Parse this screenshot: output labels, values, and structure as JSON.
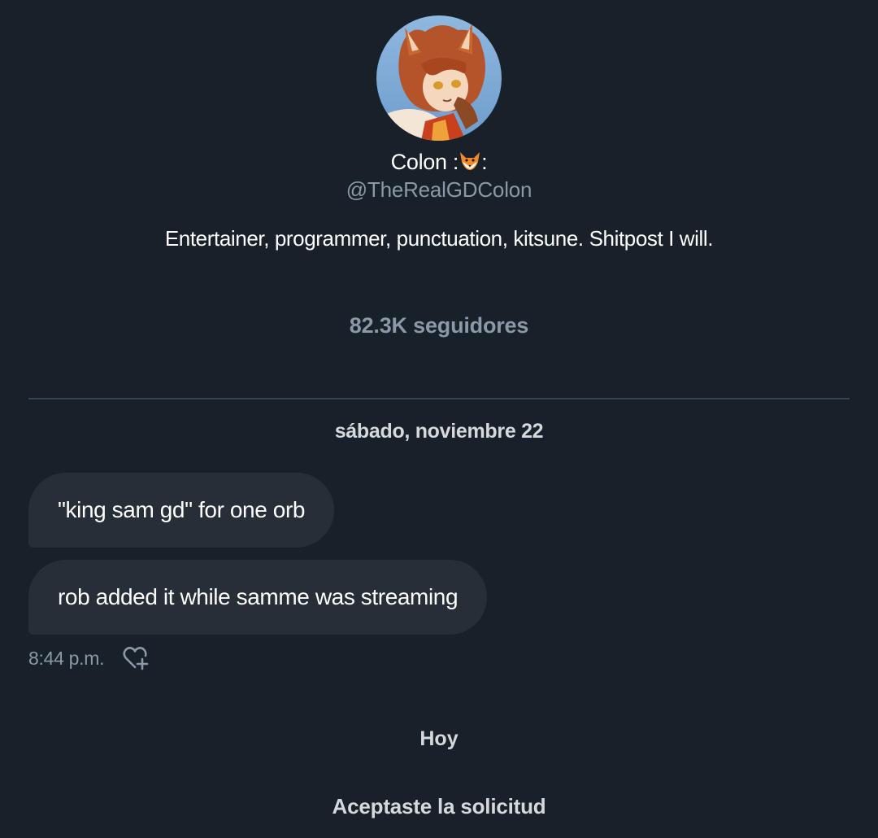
{
  "profile": {
    "display_name": "Colon :",
    "display_name_suffix": ":",
    "emoji": "fox-face-icon",
    "handle": "@TheRealGDColon",
    "bio": "Entertainer, programmer, punctuation, kitsune. Shitpost I will.",
    "followers": "82.3K seguidores"
  },
  "conversation": {
    "date_separator": "sábado, noviembre 22",
    "messages": [
      {
        "text": "\"king sam gd\" for one orb"
      },
      {
        "text": "rob added it while samme was streaming"
      }
    ],
    "last_message_time": "8:44 p.m.",
    "reaction_icon": "heart-plus-icon",
    "today_separator": "Hoy",
    "request_notice": "Aceptaste la solicitud"
  },
  "colors": {
    "background": "#18202a",
    "bubble": "#262e37",
    "muted_text": "#8b98a5",
    "divider": "#38444d"
  }
}
